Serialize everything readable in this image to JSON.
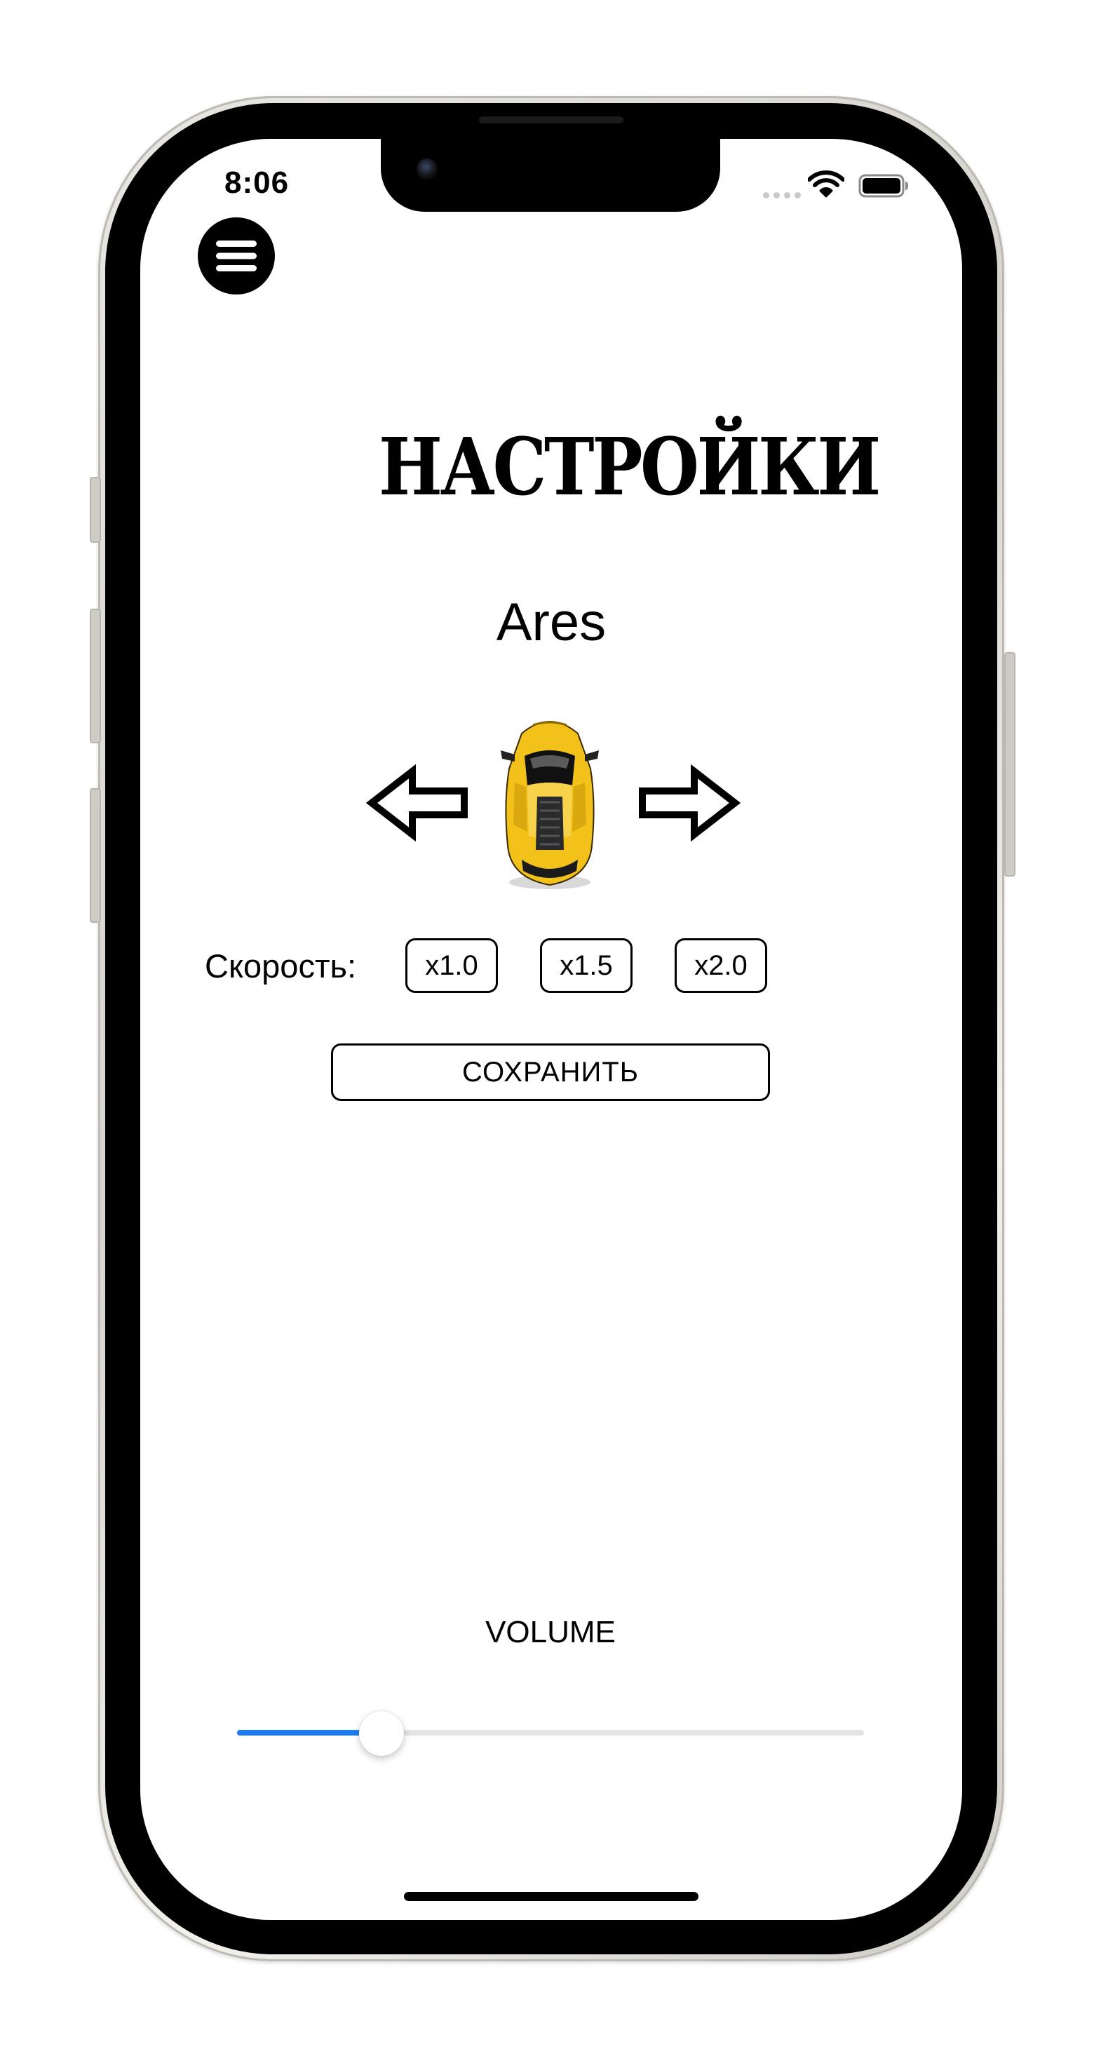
{
  "status_bar": {
    "time": "8:06"
  },
  "header": {
    "menu_icon": "hamburger-menu-icon",
    "title": "НАСТРОЙКИ"
  },
  "car_selector": {
    "car_name": "Ares",
    "prev_icon": "arrow-left-icon",
    "next_icon": "arrow-right-icon",
    "car_color": "#f2c21a"
  },
  "speed": {
    "label": "Скорость:",
    "options": [
      "x1.0",
      "x1.5",
      "x2.0"
    ]
  },
  "save_label": "СОХРАНИТЬ",
  "volume": {
    "label": "VOLUME",
    "value_fraction": 0.23,
    "accent_color": "#1a7cf6"
  }
}
